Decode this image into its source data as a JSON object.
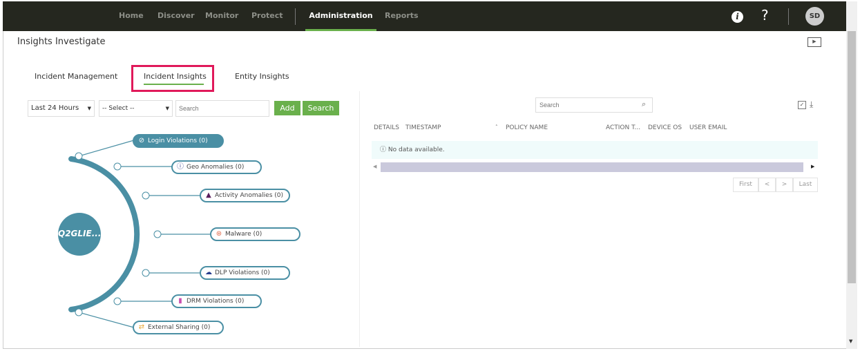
{
  "nav": {
    "items": [
      "Home",
      "Discover",
      "Monitor",
      "Protect",
      "Administration",
      "Reports"
    ],
    "active": "Administration",
    "user_initials": "SD"
  },
  "page": {
    "title": "Insights Investigate"
  },
  "tabs": [
    "Incident Management",
    "Incident Insights",
    "Entity Insights"
  ],
  "filters": {
    "time": "Last 24 Hours",
    "select": "-- Select --",
    "search_placeholder": "Search",
    "add": "Add",
    "search": "Search"
  },
  "graph": {
    "center": "Q2GLIE...",
    "nodes": [
      "Login Violations (0)",
      "Geo Anomalies (0)",
      "Activity Anomalies (0)",
      "Malware (0)",
      "DLP Violations (0)",
      "DRM Violations (0)",
      "External Sharing (0)"
    ]
  },
  "table": {
    "search_placeholder": "Search",
    "columns": [
      "DETAILS",
      "TIMESTAMP",
      "POLICY NAME",
      "ACTION T...",
      "DEVICE OS",
      "USER EMAIL"
    ],
    "empty": "No data available.",
    "pager": [
      "First",
      "<",
      ">",
      "Last"
    ]
  },
  "colors": {
    "accent": "#6ab04c",
    "graph": "#4a8fa4",
    "highlight": "#e0195a"
  }
}
